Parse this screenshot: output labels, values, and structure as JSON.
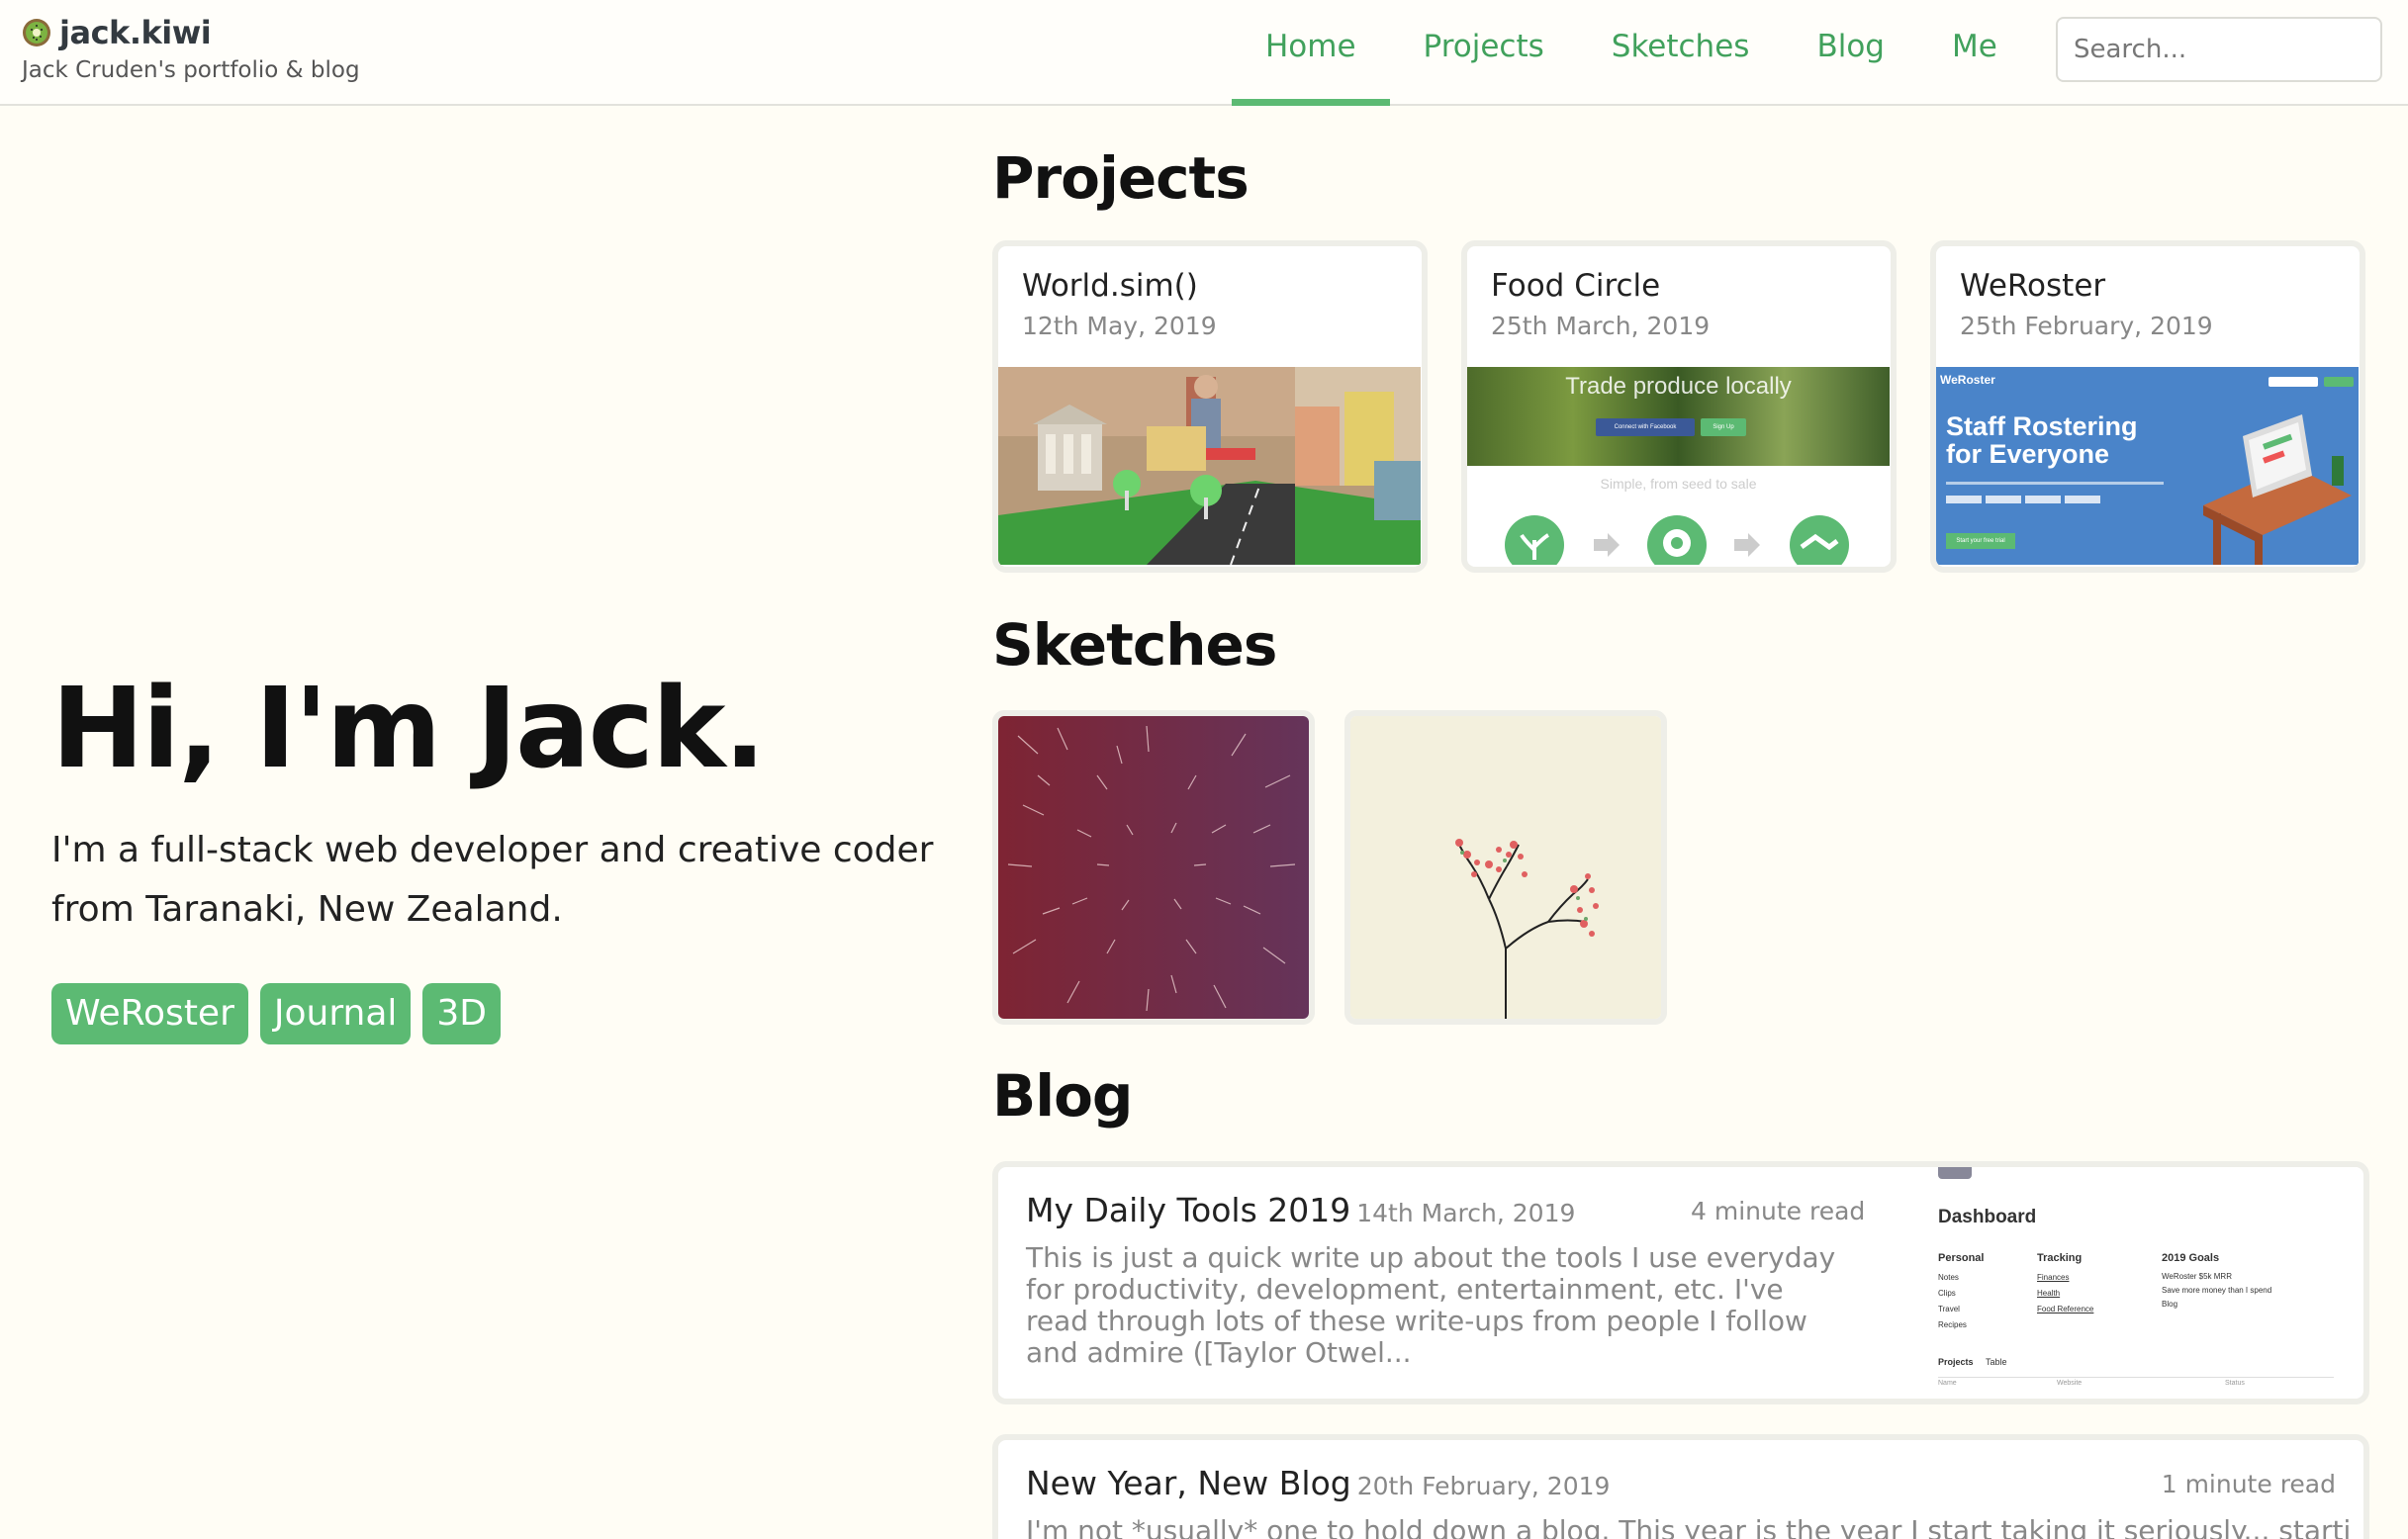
{
  "header": {
    "site_name": "jack.kiwi",
    "tagline": "Jack Cruden's portfolio & blog",
    "nav": [
      "Home",
      "Projects",
      "Sketches",
      "Blog",
      "Me"
    ],
    "active_nav": "Home",
    "search_placeholder": "Search..."
  },
  "hero": {
    "title": "Hi, I'm Jack.",
    "text": "I'm a full-stack web developer and creative coder from Taranaki, New Zealand.",
    "tags": [
      "WeRoster",
      "Journal",
      "3D"
    ]
  },
  "projects": {
    "heading": "Projects",
    "items": [
      {
        "title": "World.sim()",
        "date": "12th May, 2019"
      },
      {
        "title": "Food Circle",
        "date": "25th March, 2019",
        "image_text": {
          "headline": "Trade produce locally",
          "fb_button": "Connect with Facebook",
          "signup": "Sign Up",
          "sub": "Simple, from seed to sale"
        }
      },
      {
        "title": "WeRoster",
        "date": "25th February, 2019",
        "image_text": {
          "brand": "WeRoster",
          "headline1": "Staff Rostering",
          "headline2": "for Everyone",
          "cta": "Start your free trial"
        }
      }
    ]
  },
  "sketches": {
    "heading": "Sketches"
  },
  "blog": {
    "heading": "Blog",
    "posts": [
      {
        "title": "My Daily Tools 2019",
        "date": "14th March, 2019",
        "read_time": "4 minute read",
        "excerpt": "This is just a quick write up about the tools I use everyday for productivity, development, entertainment, etc. I've read through lots of these write-ups from people I follow and admire ([Taylor Otwel...",
        "preview": {
          "title": "Dashboard",
          "columns": [
            {
              "heading": "Personal",
              "items": [
                "Notes",
                "Clips",
                "Travel",
                "Recipes"
              ]
            },
            {
              "heading": "Tracking",
              "items": [
                "Finances",
                "Health",
                "Food Reference"
              ]
            },
            {
              "heading": "2019 Goals",
              "items": [
                "WeRoster $5k MRR",
                "Save more money than I spend",
                "Blog"
              ]
            }
          ],
          "projects_label": "Projects",
          "table_label": "Table",
          "table_cols": [
            "Name",
            "Website",
            "Status"
          ]
        }
      },
      {
        "title": "New Year, New Blog",
        "date": "20th February, 2019",
        "read_time": "1 minute read",
        "excerpt": "I'm not *usually* one to hold down a blog. This year is the year I start taking it seriously... starting February"
      }
    ]
  },
  "colors": {
    "accent": "#5cba73",
    "nav_text": "#41a15c",
    "background": "#fffdf5"
  }
}
